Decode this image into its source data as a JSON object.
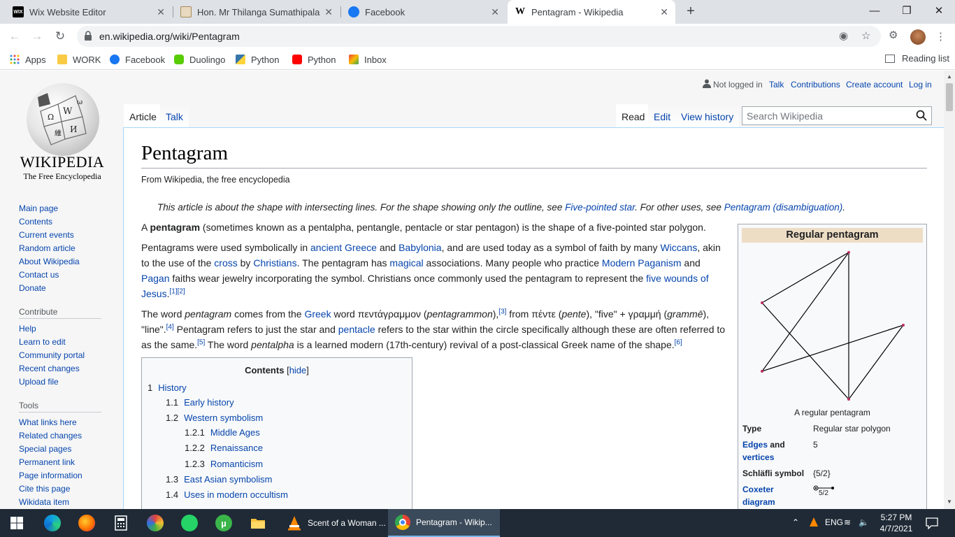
{
  "browser": {
    "tabs": [
      {
        "title": "Wix Website Editor",
        "favicon": "wix-icon",
        "favicon_text": "WIX",
        "close": "✕"
      },
      {
        "title": "Hon. Mr Thilanga Sumathipala A",
        "favicon": "emblem-icon",
        "close": "✕"
      },
      {
        "title": "Facebook",
        "favicon": "facebook-icon",
        "close": "✕"
      },
      {
        "title": "Pentagram - Wikipedia",
        "favicon": "wikipedia-icon",
        "favicon_text": "W",
        "close": "✕"
      }
    ],
    "url": "en.wikipedia.org/wiki/Pentagram",
    "bookmarks": [
      {
        "label": "Apps",
        "icon": "apps-grid-icon"
      },
      {
        "label": "WORK",
        "icon": "folder-icon"
      },
      {
        "label": "Facebook",
        "icon": "facebook-icon"
      },
      {
        "label": "Duolingo",
        "icon": "duolingo-icon"
      },
      {
        "label": "Python",
        "icon": "python-icon"
      },
      {
        "label": "Python",
        "icon": "youtube-icon"
      },
      {
        "label": "Inbox",
        "icon": "gmail-icon"
      }
    ],
    "reading_list": "Reading list"
  },
  "wiki": {
    "logo": {
      "wordmark": "WIKIPEDIA",
      "tagline": "The Free Encyclopedia"
    },
    "nav": [
      "Main page",
      "Contents",
      "Current events",
      "Random article",
      "About Wikipedia",
      "Contact us",
      "Donate"
    ],
    "contribute": {
      "heading": "Contribute",
      "items": [
        "Help",
        "Learn to edit",
        "Community portal",
        "Recent changes",
        "Upload file"
      ]
    },
    "tools": {
      "heading": "Tools",
      "items": [
        "What links here",
        "Related changes",
        "Special pages",
        "Permanent link",
        "Page information",
        "Cite this page",
        "Wikidata item"
      ]
    },
    "personal": {
      "not_logged_in": "Not logged in",
      "talk": "Talk",
      "contributions": "Contributions",
      "create_account": "Create account",
      "login": "Log in"
    },
    "tabs": {
      "article": "Article",
      "talk": "Talk",
      "read": "Read",
      "edit": "Edit",
      "history": "View history"
    },
    "search_placeholder": "Search Wikipedia",
    "article": {
      "title": "Pentagram",
      "from": "From Wikipedia, the free encyclopedia",
      "hatnote": {
        "a": "This article is about the shape with intersecting lines. For the shape showing only the outline, see ",
        "link1": "Five-pointed star",
        "b": ". For other uses, see ",
        "link2": "Pentagram (disambiguation)",
        "c": "."
      },
      "p1": {
        "a": "A ",
        "bold": "pentagram",
        "b": " (sometimes known as a pentalpha, pentangle, pentacle or star pentagon) is the shape of a five-pointed star polygon."
      },
      "p2": {
        "t1": "Pentagrams were used symbolically in ",
        "l1": "ancient Greece",
        "t2": " and ",
        "l2": "Babylonia",
        "t3": ", and are used today as a symbol of faith by many ",
        "l3": "Wiccans",
        "t4": ", akin to the use of the ",
        "l4": "cross",
        "t5": " by ",
        "l5": "Christians",
        "t6": ". The pentagram has ",
        "l6": "magical",
        "t7": " associations. Many people who practice ",
        "l7": "Modern Paganism",
        "t8": " and ",
        "l8": "Pagan",
        "t9": " faiths wear jewelry incorporating the symbol. Christians once commonly used the pentagram to represent the ",
        "l9": "five wounds of Jesus",
        "t10": ".",
        "ref1": "[1]",
        "ref2": "[2]"
      },
      "p3": {
        "t1": "The word ",
        "i1": "pentagram",
        "t2": " comes from the ",
        "l1": "Greek",
        "t3": " word πεντάγραμμον (",
        "i2": "pentagrammon",
        "t4": "),",
        "ref3": "[3]",
        "t5": " from πέντε (",
        "i3": "pente",
        "t6": "), \"five\" + γραμμή (",
        "i4": "grammē",
        "t7": "), \"line\".",
        "ref4": "[4]",
        "t8": " Pentagram refers to just the star and ",
        "l2": "pentacle",
        "t9": " refers to the star within the circle specifically although these are often referred to as the same.",
        "ref5": "[5]",
        "t10": " The word ",
        "i5": "pentalpha",
        "t11": " is a learned modern (17th-century) revival of a post-classical Greek name of the shape.",
        "ref6": "[6]"
      }
    },
    "toc": {
      "title": "Contents",
      "hide": "hide",
      "open_bracket": "[",
      "close_bracket": "]",
      "items": [
        {
          "num": "1",
          "label": "History"
        },
        {
          "num": "1.1",
          "label": "Early history"
        },
        {
          "num": "1.2",
          "label": "Western symbolism"
        },
        {
          "num": "1.2.1",
          "label": "Middle Ages"
        },
        {
          "num": "1.2.2",
          "label": "Renaissance"
        },
        {
          "num": "1.2.3",
          "label": "Romanticism"
        },
        {
          "num": "1.3",
          "label": "East Asian symbolism"
        },
        {
          "num": "1.4",
          "label": "Uses in modern occultism"
        }
      ]
    },
    "infobox": {
      "title": "Regular pentagram",
      "caption": "A regular pentagram",
      "type_label": "Type",
      "type_value": "Regular star polygon",
      "edges_label_a": "Edges",
      "edges_label_b": " and",
      "edges_label_c": "vertices",
      "edges_value": "5",
      "schlafli_label": "Schläfli symbol",
      "schlafli_value": "{5/2}",
      "coxeter_label_a": "Coxeter",
      "coxeter_label_b": "diagram",
      "coxeter_value": "5/2"
    }
  },
  "taskbar": {
    "apps": [
      {
        "label": "Scent of a Woman ...",
        "icon": "vlc-icon"
      },
      {
        "label": "Pentagram - Wikip...",
        "icon": "chrome-icon"
      }
    ],
    "time": "5:27 PM",
    "date": "4/7/2021",
    "ime": "ENG"
  },
  "colors": {
    "link": "#0645ad",
    "infobox_header": "#eeddc5",
    "taskbar": "#1f2a36"
  }
}
